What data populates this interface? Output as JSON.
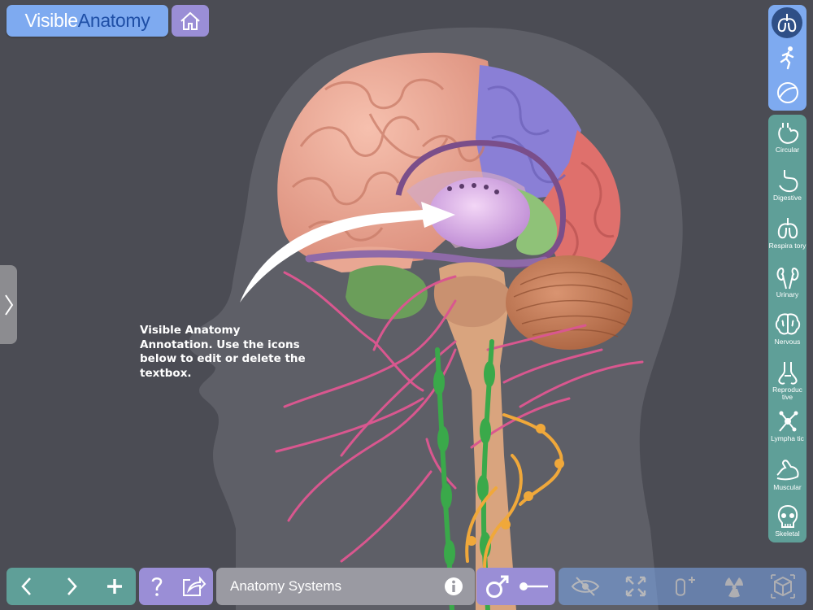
{
  "app": {
    "logo_part1": "Visible",
    "logo_part2": "Anatomy"
  },
  "annotation": {
    "text": "Visible Anatomy Annotation. Use the icons below to edit or delete the textbox."
  },
  "view_modes": [
    {
      "name": "lungs-view",
      "active": true
    },
    {
      "name": "body-figure",
      "active": false
    },
    {
      "name": "sphere-view",
      "active": false
    }
  ],
  "systems": [
    {
      "label": "Circular",
      "icon": "heart-icon"
    },
    {
      "label": "Digestive",
      "icon": "stomach-icon"
    },
    {
      "label": "Respira tory",
      "icon": "lungs-icon"
    },
    {
      "label": "Urinary",
      "icon": "kidneys-icon"
    },
    {
      "label": "Nervous",
      "icon": "brain-icon",
      "active": true
    },
    {
      "label": "Reproduc tive",
      "icon": "reproductive-icon"
    },
    {
      "label": "Lympha tic",
      "icon": "lymph-node-icon"
    },
    {
      "label": "Muscular",
      "icon": "muscle-arm-icon"
    },
    {
      "label": "Skeletal",
      "icon": "skull-icon"
    }
  ],
  "bottom_bar": {
    "system_title": "Anatomy Systems"
  },
  "colors": {
    "background": "#4b4c54",
    "head_silhouette": "#5e5f67",
    "accent_blue": "#7eaaf0",
    "accent_teal": "#5f9f98",
    "accent_purple": "#9a8ed6",
    "cerebrum_pink": "#e7a391",
    "parietal_blue": "#8a7fd6",
    "occipital_red": "#df706c",
    "cerebellum_brown": "#c07a55",
    "nerve_pink": "#d9578f",
    "sympathetic_green": "#3aa94a",
    "nerve_orange": "#f0a83a"
  }
}
